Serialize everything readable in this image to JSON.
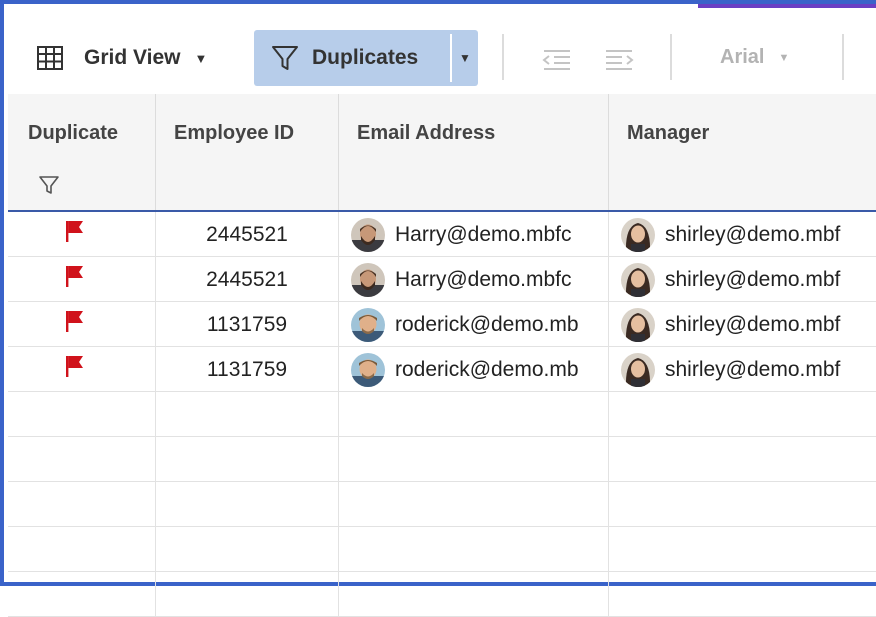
{
  "toolbar": {
    "view_label": "Grid View",
    "filter_label": "Duplicates",
    "font_label": "Arial"
  },
  "columns": [
    {
      "label": "Duplicate"
    },
    {
      "label": "Employee ID"
    },
    {
      "label": "Email Address"
    },
    {
      "label": "Manager"
    }
  ],
  "rows": [
    {
      "employee_id": "2445521",
      "email": "Harry@demo.mbfc",
      "manager": "shirley@demo.mbf"
    },
    {
      "employee_id": "2445521",
      "email": "Harry@demo.mbfc",
      "manager": "shirley@demo.mbf"
    },
    {
      "employee_id": "1131759",
      "email": "roderick@demo.mb",
      "manager": "shirley@demo.mbf"
    },
    {
      "employee_id": "1131759",
      "email": "roderick@demo.mb",
      "manager": "shirley@demo.mbf"
    }
  ],
  "colors": {
    "frame_border": "#3a63c9",
    "filter_button_bg": "#b7cdea",
    "flag": "#d0121b",
    "header_bg": "#f5f5f5"
  },
  "icons": {
    "view": "grid-icon",
    "filter": "filter-icon",
    "duplicate_marker": "flag-icon",
    "outdent": "outdent-icon",
    "indent": "indent-icon"
  }
}
